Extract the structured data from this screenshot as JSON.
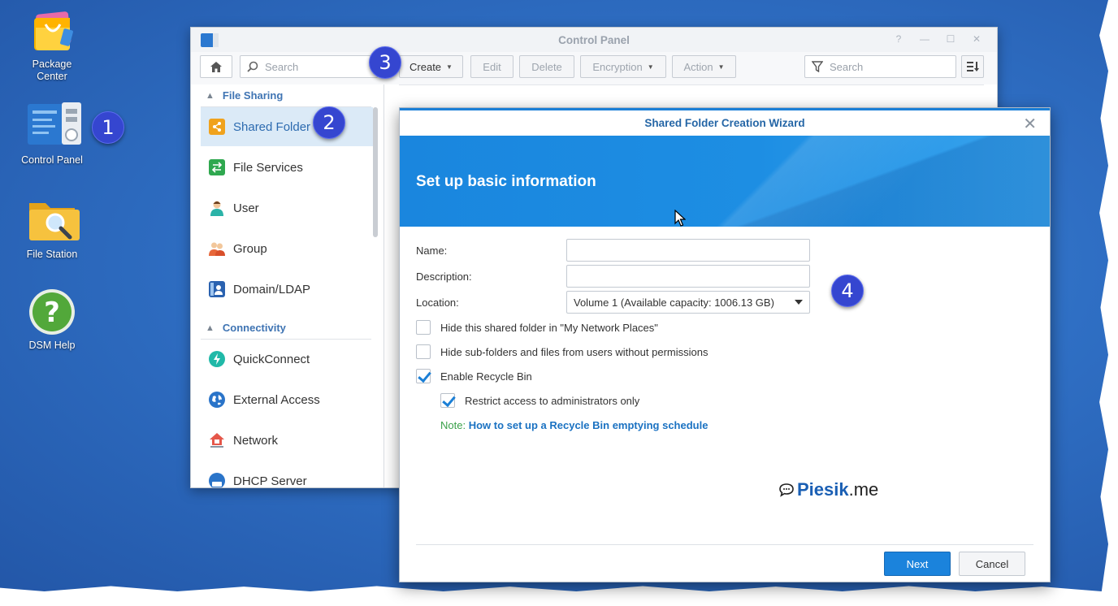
{
  "desktop": {
    "icons": [
      {
        "label": "Package\nCenter",
        "line1": "Package",
        "line2": "Center",
        "icon": "package-center-icon"
      },
      {
        "label": "Control Panel",
        "icon": "control-panel-icon"
      },
      {
        "label": "File Station",
        "icon": "file-station-icon"
      },
      {
        "label": "DSM Help",
        "icon": "help-icon"
      }
    ]
  },
  "badges": [
    "1",
    "2",
    "3",
    "4"
  ],
  "control_panel": {
    "title": "Control Panel",
    "search_placeholder": "Search",
    "toolbar": {
      "create": "Create",
      "edit": "Edit",
      "delete": "Delete",
      "encryption": "Encryption",
      "action": "Action",
      "filter_placeholder": "Search"
    },
    "sidebar": {
      "sections": [
        {
          "title": "File Sharing",
          "items": [
            {
              "label": "Shared Folder",
              "icon": "shared-folder-icon",
              "active": true
            },
            {
              "label": "File Services",
              "icon": "file-services-icon"
            },
            {
              "label": "User",
              "icon": "user-icon"
            },
            {
              "label": "Group",
              "icon": "group-icon"
            },
            {
              "label": "Domain/LDAP",
              "icon": "domain-ldap-icon"
            }
          ]
        },
        {
          "title": "Connectivity",
          "items": [
            {
              "label": "QuickConnect",
              "icon": "quickconnect-icon"
            },
            {
              "label": "External Access",
              "icon": "globe-icon"
            },
            {
              "label": "Network",
              "icon": "network-icon"
            },
            {
              "label": "DHCP Server",
              "icon": "dhcp-server-icon"
            }
          ]
        }
      ]
    }
  },
  "wizard": {
    "title": "Shared Folder Creation Wizard",
    "heading": "Set up basic information",
    "fields": {
      "name_label": "Name:",
      "name_value": "",
      "description_label": "Description:",
      "description_value": "",
      "location_label": "Location:",
      "location_value": "Volume 1 (Available capacity: 1006.13 GB)"
    },
    "checkboxes": [
      {
        "label": "Hide this shared folder in \"My Network Places\"",
        "checked": false
      },
      {
        "label": "Hide sub-folders and files from users without permissions",
        "checked": false
      },
      {
        "label": "Enable Recycle Bin",
        "checked": true
      },
      {
        "label": "Restrict access to administrators only",
        "checked": true
      }
    ],
    "note_label": "Note:",
    "note_link": "How to set up a Recycle Bin emptying schedule",
    "watermark_brand": "Piesik",
    "watermark_suffix": ".me",
    "next": "Next",
    "cancel": "Cancel"
  },
  "colors": {
    "accent": "#1b7fd6",
    "desktop": "#2f6fc4",
    "badge": "#3546d0",
    "active_item_bg": "#dbeaf7"
  }
}
